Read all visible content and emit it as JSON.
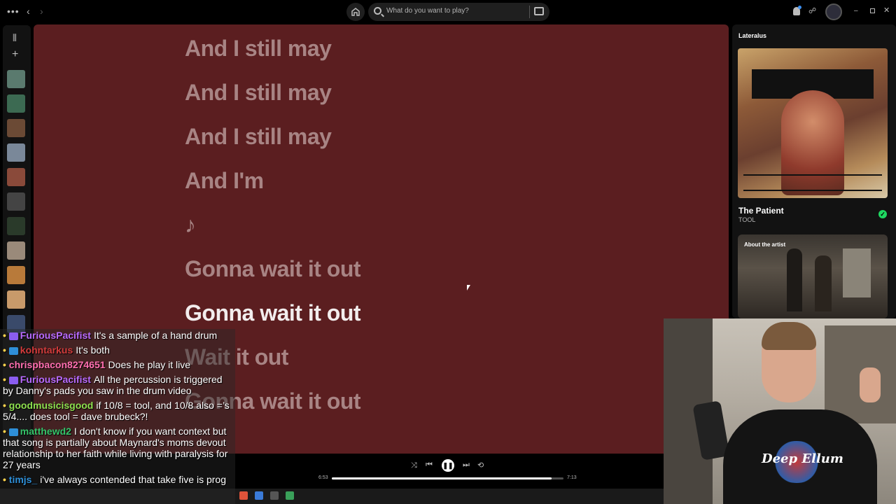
{
  "topbar": {
    "menu_icon": "more-dots-icon",
    "back_icon": "chevron-left-icon",
    "forward_icon": "chevron-right-icon",
    "home_icon": "home-icon",
    "search_placeholder": "What do you want to play?",
    "browse_icon": "browse-icon",
    "bell_icon": "bell-icon",
    "friends_icon": "friends-icon",
    "minimize": "–",
    "close": "✕"
  },
  "lyrics": {
    "lines": [
      "And I still may",
      "And I still may",
      "And I still may",
      "And I'm",
      "♪",
      "Gonna wait it out",
      "Gonna wait it out",
      "Wait it out",
      "Gonna wait it out"
    ],
    "active_index": 6
  },
  "right_panel": {
    "context_title": "Lateralus",
    "track_title": "The Patient",
    "track_artist": "TOOL",
    "saved_icon": "check-circle-icon",
    "about_label": "About the artist"
  },
  "player": {
    "current_time": "6:53",
    "total_time": "7:13",
    "progress_fraction": 0.95,
    "shuffle_icon": "⤨",
    "prev_icon": "⏮",
    "play_pause_icon": "❚❚",
    "next_icon": "⏭",
    "repeat_icon": "⟲"
  },
  "chat": {
    "messages": [
      {
        "badge": "sub",
        "user": "FuriousPacifist",
        "user_color": "#b96bff",
        "text": "It's a sample of a hand drum"
      },
      {
        "badge": "blue",
        "user": "kohntarkus",
        "user_color": "#d23b3b",
        "text": "It's both"
      },
      {
        "badge": "none",
        "user": "chrispbacon8274651",
        "user_color": "#ff6fb0",
        "text": "Does he play it live"
      },
      {
        "badge": "sub",
        "user": "FuriousPacifist",
        "user_color": "#b96bff",
        "text": "All the percussion is triggered by Danny's pads you saw in the drum video"
      },
      {
        "badge": "none",
        "user": "goodmusicisgood",
        "user_color": "#8ee04f",
        "text": "if 10/8 = tool, and 10/8 also =’s 5/4.... does tool = dave brubeck?!"
      },
      {
        "badge": "blue",
        "user": "matthewd2",
        "user_color": "#35c46a",
        "text": "I don't know if you want context but that song is partially about Maynard's moms devout relationship to her faith while living with paralysis for 27 years"
      },
      {
        "badge": "none",
        "user": "timjs_",
        "user_color": "#2e8fd8",
        "text": "i've always contended that take five is prog"
      }
    ]
  }
}
